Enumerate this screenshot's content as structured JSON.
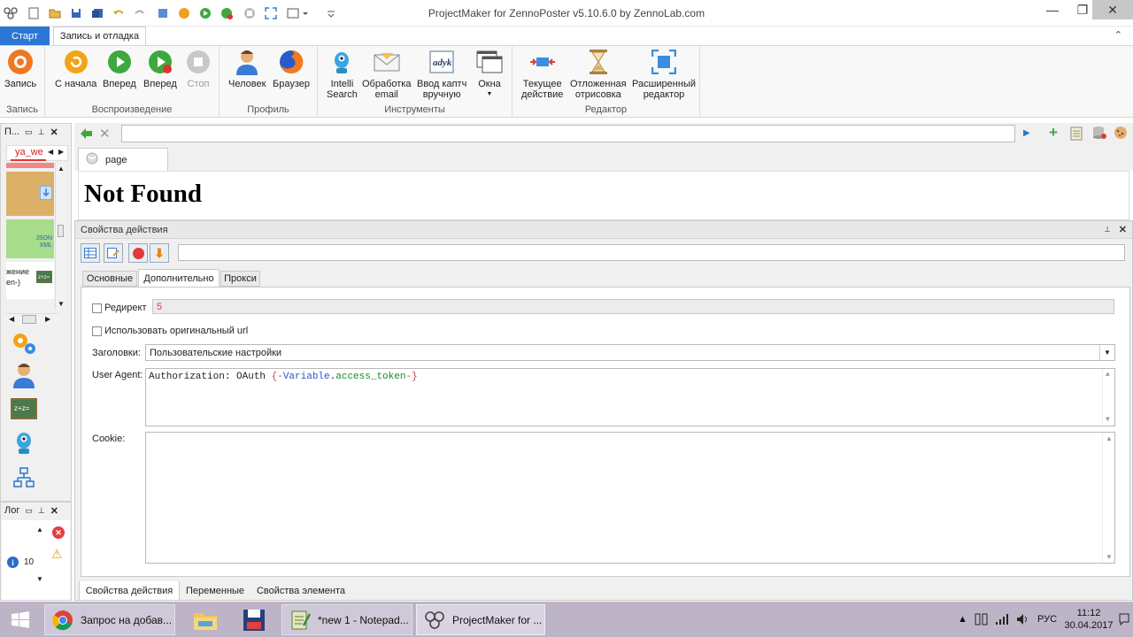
{
  "window": {
    "title": "ProjectMaker for ZennoPoster v5.10.6.0 by ZennoLab.com",
    "minimize": "—",
    "maximize": "❐",
    "close": "✕"
  },
  "ribbon_tabs": {
    "start": "Старт",
    "record_debug": "Запись и отладка",
    "expand": "⌃"
  },
  "ribbon_groups": {
    "record": "Запись",
    "playback": "Воспроизведение",
    "profile": "Профиль",
    "tools": "Инструменты",
    "editor": "Редактор"
  },
  "ribbon_buttons": {
    "record": "Запись",
    "from_start": "С начала",
    "forward": "Вперед",
    "forward2": "Вперед",
    "stop": "Стоп",
    "human": "Человек",
    "browser": "Браузер",
    "intelli_search_1": "Intelli",
    "intelli_search_2": "Search",
    "email_1": "Обработка",
    "email_2": "email",
    "captcha_1": "Ввод каптч",
    "captcha_2": "вручную",
    "windows": "Окна",
    "current_action_1": "Текущее",
    "current_action_2": "действие",
    "deferred_1": "Отложенная",
    "deferred_2": "отрисовка",
    "extended_1": "Расширенный",
    "extended_2": "редактор"
  },
  "left_panel": {
    "title": "П...",
    "tab": "ya_we",
    "item_text_1": "жение",
    "item_text_2": "en-)",
    "json_label": "JSON",
    "xml_label": "XML"
  },
  "log_panel": {
    "title": "Лог",
    "count": "10"
  },
  "url_bar": {
    "value": ""
  },
  "page_tab": {
    "label": "page"
  },
  "webview": {
    "heading": "Not Found"
  },
  "props_panel": {
    "title": "Свойства действия",
    "tabs": [
      "Основные",
      "Дополнительно",
      "Прокси"
    ],
    "redirect_label": "Редирект",
    "redirect_value": "5",
    "use_original_url": "Использовать оригинальный url",
    "headers_label": "Заголовки:",
    "headers_value": "Пользовательские настройки",
    "user_agent_label": "User Agent:",
    "ua_prefix": "Authorization: OAuth ",
    "ua_open": "{-",
    "ua_var": "Variable",
    "ua_dot": ".",
    "ua_name": "access_token",
    "ua_close": "-}",
    "cookie_label": "Cookie:",
    "bottom_tabs": [
      "Свойства действия",
      "Переменные",
      "Свойства элемента"
    ]
  },
  "taskbar": {
    "chrome": "Запрос на добав...",
    "notepad": "*new 1 - Notepad...",
    "projectmaker": "ProjectMaker for ...",
    "lang": "РУС",
    "time": "11:12",
    "date": "30.04.2017"
  }
}
